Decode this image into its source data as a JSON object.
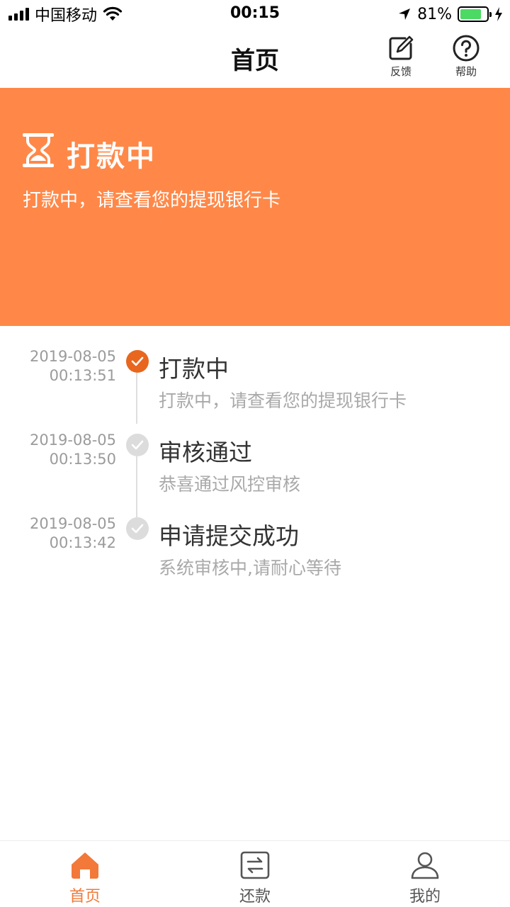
{
  "status_bar": {
    "carrier": "中国移动",
    "time": "00:15",
    "battery_percent": "81%",
    "battery_level": 0.81
  },
  "nav": {
    "title": "首页",
    "feedback_label": "反馈",
    "help_label": "帮助"
  },
  "banner": {
    "title": "打款中",
    "subtitle": "打款中，请查看您的提现银行卡",
    "icon": "hourglass-icon",
    "color": "#ff8848"
  },
  "timeline": {
    "items": [
      {
        "date": "2019-08-05",
        "time": "00:13:51",
        "title": "打款中",
        "desc": "打款中，请查看您的提现银行卡",
        "state": "active"
      },
      {
        "date": "2019-08-05",
        "time": "00:13:50",
        "title": "审核通过",
        "desc": "恭喜通过风控审核",
        "state": "done"
      },
      {
        "date": "2019-08-05",
        "time": "00:13:42",
        "title": "申请提交成功",
        "desc": "系统审核中,请耐心等待",
        "state": "done"
      }
    ],
    "active_color": "#e8661e",
    "done_color": "#dcdcdc"
  },
  "tabbar": {
    "tabs": [
      {
        "label": "首页",
        "icon": "home-icon",
        "active": true
      },
      {
        "label": "还款",
        "icon": "exchange-icon",
        "active": false
      },
      {
        "label": "我的",
        "icon": "person-icon",
        "active": false
      }
    ],
    "active_color": "#f2793a"
  }
}
